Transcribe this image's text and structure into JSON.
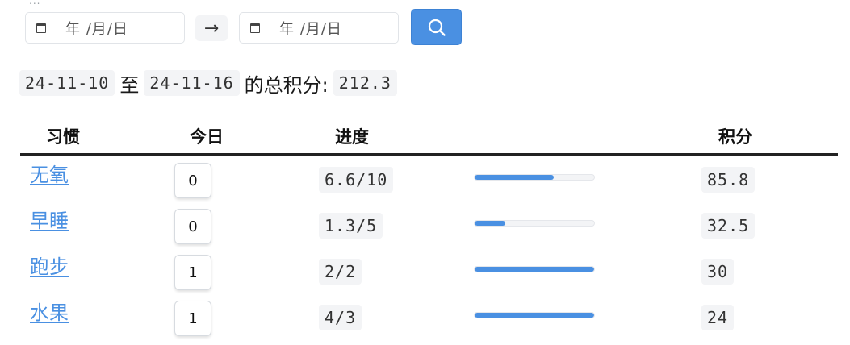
{
  "filter": {
    "overflow_dots": "...",
    "start_date_placeholder": "年 /月/日",
    "end_date_placeholder": "年 /月/日",
    "arrow": "→",
    "search_icon": "search-icon"
  },
  "summary": {
    "start_date": "24-11-10",
    "connector": "至",
    "end_date": "24-11-16",
    "suffix": "的总积分:",
    "total": "212.3"
  },
  "table": {
    "headers": {
      "habit": "习惯",
      "today": "今日",
      "progress": "进度",
      "score": "积分"
    },
    "rows": [
      {
        "habit": "无氧",
        "today": "0",
        "progress": "6.6/10",
        "fraction": 0.66,
        "score": "85.8"
      },
      {
        "habit": "早睡",
        "today": "0",
        "progress": "1.3/5",
        "fraction": 0.26,
        "score": "32.5"
      },
      {
        "habit": "跑步",
        "today": "1",
        "progress": "2/2",
        "fraction": 1.0,
        "score": "30"
      },
      {
        "habit": "水果",
        "today": "1",
        "progress": "4/3",
        "fraction": 1.0,
        "score": "24"
      }
    ]
  },
  "colors": {
    "accent": "#4a90e2",
    "code_bg": "#f3f4f6"
  }
}
